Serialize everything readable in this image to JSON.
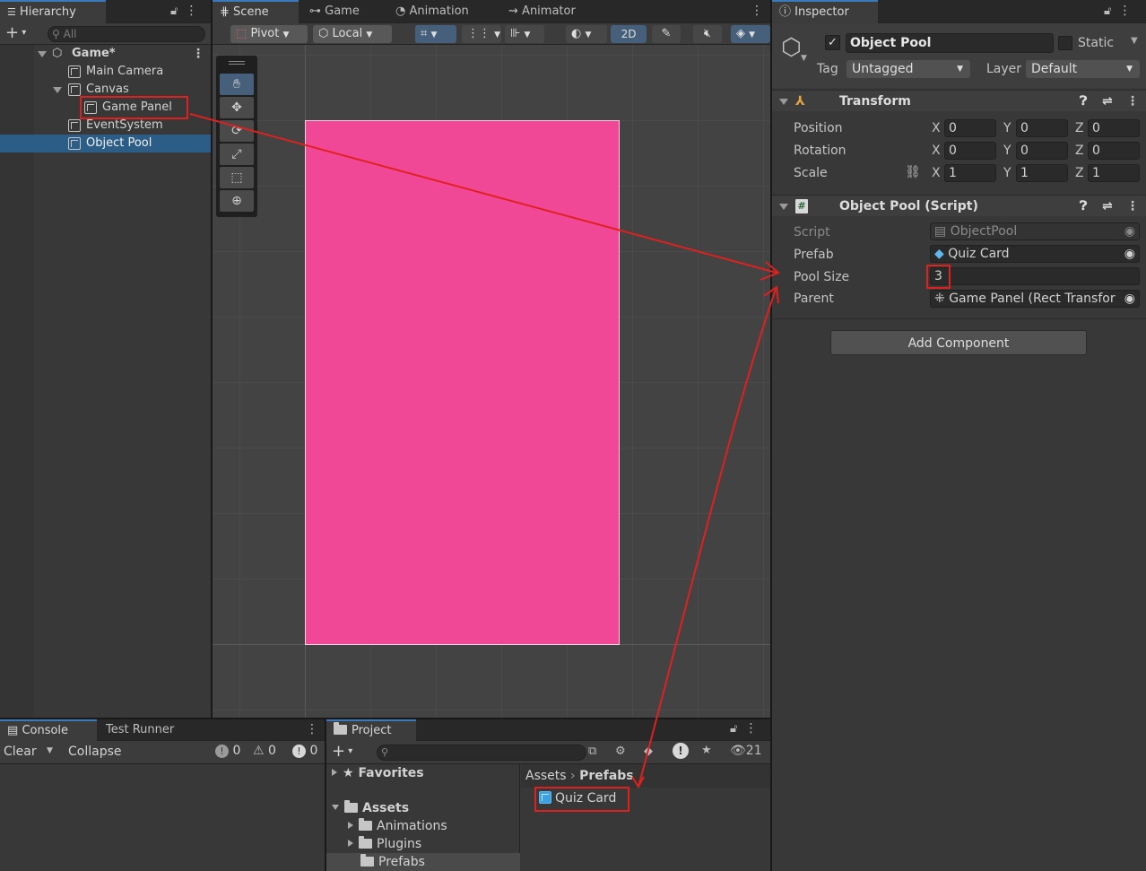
{
  "hierarchy": {
    "tab": "Hierarchy",
    "search_placeholder": "All",
    "scene": "Game*",
    "items": [
      {
        "label": "Main Camera"
      },
      {
        "label": "Canvas"
      },
      {
        "label": "Game Panel"
      },
      {
        "label": "EventSystem"
      },
      {
        "label": "Object Pool"
      }
    ]
  },
  "scene_view": {
    "tabs": [
      "Scene",
      "Game",
      "Animation",
      "Animator"
    ],
    "pivot": "Pivot",
    "local": "Local",
    "mode_2d": "2D",
    "panel_color": "#f14797"
  },
  "inspector": {
    "tab": "Inspector",
    "object_name": "Object Pool",
    "static_label": "Static",
    "tag_label": "Tag",
    "tag_value": "Untagged",
    "layer_label": "Layer",
    "layer_value": "Default",
    "transform": {
      "title": "Transform",
      "position": {
        "label": "Position",
        "x": "0",
        "y": "0",
        "z": "0"
      },
      "rotation": {
        "label": "Rotation",
        "x": "0",
        "y": "0",
        "z": "0"
      },
      "scale": {
        "label": "Scale",
        "x": "1",
        "y": "1",
        "z": "1"
      },
      "axis_x": "X",
      "axis_y": "Y",
      "axis_z": "Z"
    },
    "script_component": {
      "title": "Object Pool (Script)",
      "script_label": "Script",
      "script_value": "ObjectPool",
      "prefab_label": "Prefab",
      "prefab_value": "Quiz Card",
      "pool_size_label": "Pool Size",
      "pool_size_value": "3",
      "parent_label": "Parent",
      "parent_value": "Game Panel (Rect Transfor"
    },
    "add_component": "Add Component"
  },
  "console": {
    "tabs": [
      "Console",
      "Test Runner"
    ],
    "clear": "Clear",
    "collapse": "Collapse",
    "counts": [
      "0",
      "0",
      "0"
    ]
  },
  "project": {
    "tab": "Project",
    "visible_count": "21",
    "favorites": "Favorites",
    "assets": "Assets",
    "folders": [
      "Animations",
      "Plugins",
      "Prefabs"
    ],
    "breadcrumb": [
      "Assets",
      "Prefabs"
    ],
    "asset_items": [
      "Quiz Card"
    ]
  },
  "annotation_color": "#e0201e"
}
